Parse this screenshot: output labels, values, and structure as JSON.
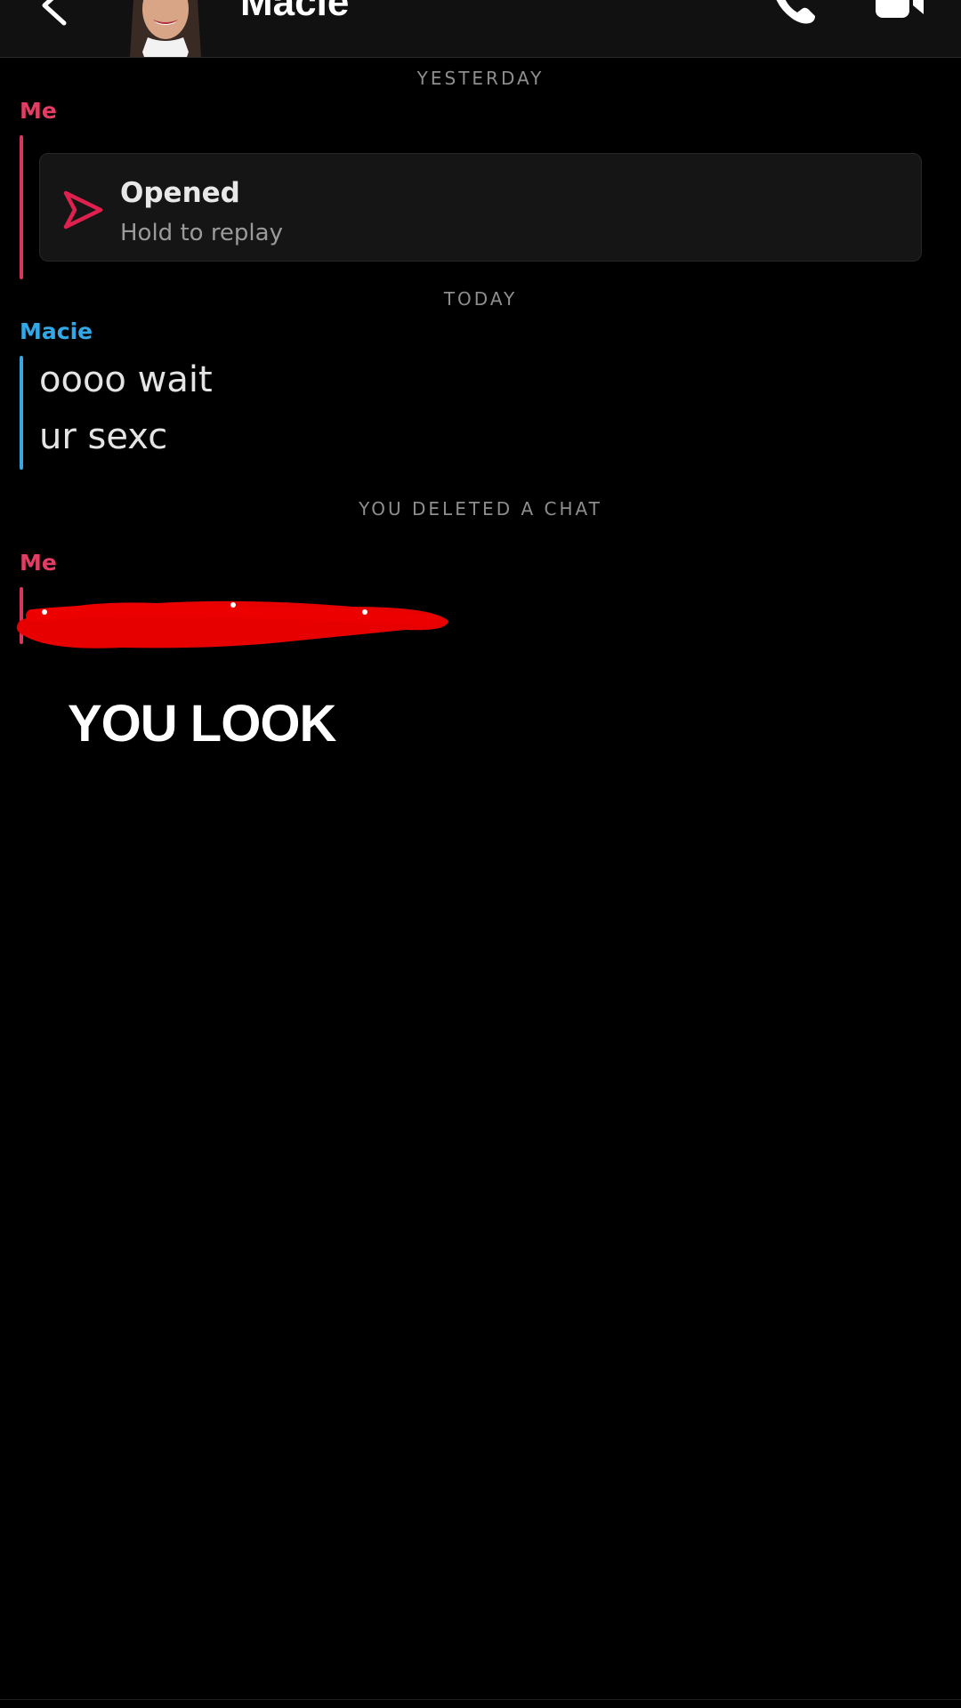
{
  "header": {
    "contact_name": "Macie",
    "icons": {
      "back": "chevron-left-icon",
      "call": "phone-icon",
      "video": "video-camera-icon"
    }
  },
  "conversation": {
    "dividers": {
      "yesterday": "YESTERDAY",
      "today": "TODAY",
      "deleted_notice": "YOU DELETED A CHAT"
    },
    "messages": [
      {
        "sender": "Me",
        "type": "snap",
        "status": "Opened",
        "sub": "Hold to replay",
        "icon": "sent-arrow-icon"
      },
      {
        "sender": "Macie",
        "type": "text",
        "lines": [
          "oooo wait",
          "ur sexc"
        ]
      },
      {
        "sender": "Me",
        "type": "text",
        "redacted": true
      }
    ]
  },
  "overlay": {
    "caption": "YOU LOOK"
  },
  "colors": {
    "me": "#e33d63",
    "macie": "#33a8e6",
    "redaction": "#e60000",
    "background": "#000000"
  }
}
